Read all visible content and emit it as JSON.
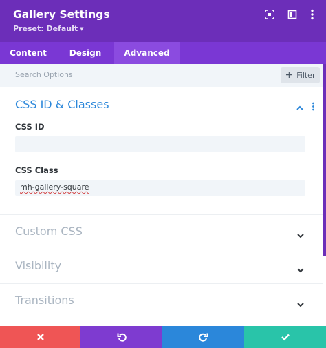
{
  "header": {
    "title": "Gallery Settings",
    "preset_label": "Preset: Default",
    "icons": [
      "expand-icon",
      "split-view-icon",
      "more-vertical-icon"
    ],
    "color": "#6c2eb9"
  },
  "tabs": [
    {
      "label": "Content",
      "active": false
    },
    {
      "label": "Design",
      "active": false
    },
    {
      "label": "Advanced",
      "active": true
    }
  ],
  "search": {
    "placeholder": "Search Options",
    "filter_label": "Filter"
  },
  "sections": {
    "css_id_classes": {
      "title": "CSS ID & Classes",
      "expanded": true,
      "css_id_label": "CSS ID",
      "css_id_value": "",
      "css_class_label": "CSS Class",
      "css_class_value": "mh-gallery-square"
    },
    "collapsed": [
      {
        "title": "Custom CSS"
      },
      {
        "title": "Visibility"
      },
      {
        "title": "Transitions"
      }
    ]
  },
  "footer": {
    "buttons": [
      {
        "name": "discard",
        "icon": "close-icon",
        "color": "#ef5555"
      },
      {
        "name": "undo",
        "icon": "undo-icon",
        "color": "#7e3bd0"
      },
      {
        "name": "redo",
        "icon": "redo-icon",
        "color": "#2b87da"
      },
      {
        "name": "save",
        "icon": "check-icon",
        "color": "#29c4a9"
      }
    ]
  }
}
